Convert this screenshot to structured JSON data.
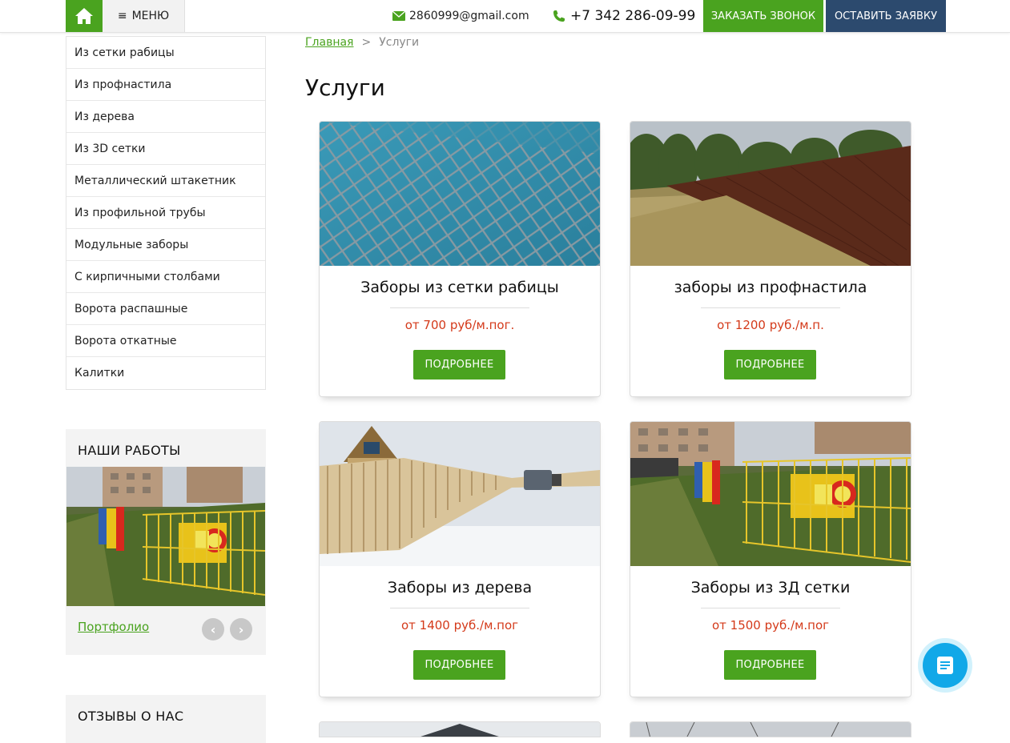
{
  "header": {
    "menu_label": "МЕНЮ",
    "email": "2860999@gmail.com",
    "phone": "+7 342 286-09-99",
    "call_button": "ЗАКАЗАТЬ ЗВОНОК",
    "request_button": "ОСТАВИТЬ ЗАЯВКУ",
    "icons": {
      "home": "home-icon",
      "menu": "bars-icon",
      "email": "envelope-icon",
      "phone": "phone-icon"
    },
    "colors": {
      "green": "#4aa31f",
      "navy": "#2c4a6e"
    }
  },
  "sidebar": {
    "items": [
      {
        "label": "Из сетки рабицы"
      },
      {
        "label": "Из профнастила"
      },
      {
        "label": "Из дерева"
      },
      {
        "label": "Из 3D сетки"
      },
      {
        "label": "Металлический штакетник"
      },
      {
        "label": "Из профильной трубы"
      },
      {
        "label": "Модульные заборы"
      },
      {
        "label": "С кирпичными столбами"
      },
      {
        "label": "Ворота распашные"
      },
      {
        "label": "Ворота откатные"
      },
      {
        "label": "Калитки"
      }
    ],
    "works": {
      "title": "НАШИ РАБОТЫ",
      "link": "Портфолио"
    },
    "reviews": {
      "title": "ОТЗЫВЫ О НАС"
    }
  },
  "breadcrumb": {
    "home": "Главная",
    "separator": ">",
    "current": "Услуги"
  },
  "page_title": "Услуги",
  "cards": [
    {
      "title": "Заборы из сетки рабицы",
      "price": "от 700 руб/м.пог.",
      "button": "ПОДРОБНЕЕ"
    },
    {
      "title": "заборы из профнастила",
      "price": "от 1200 руб./м.п.",
      "button": "ПОДРОБНЕЕ"
    },
    {
      "title": "Заборы из дерева",
      "price": "от 1400 руб./м.пог",
      "button": "ПОДРОБНЕЕ"
    },
    {
      "title": "Заборы из 3Д сетки",
      "price": "от 1500 руб./м.пог",
      "button": "ПОДРОБНЕЕ"
    }
  ],
  "price_color": "#d43a1a",
  "chat_widget": {
    "icon": "chat-document-icon",
    "color": "#11a8e8"
  }
}
